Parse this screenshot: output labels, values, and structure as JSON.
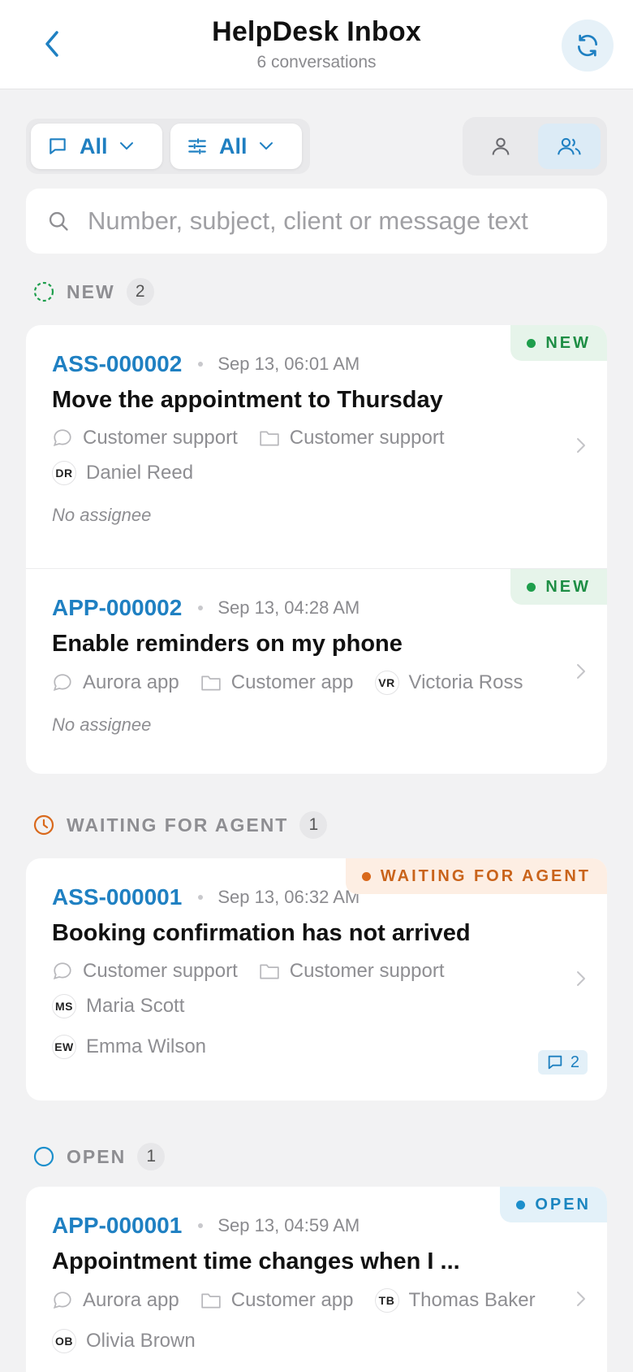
{
  "header": {
    "title": "HelpDesk Inbox",
    "subtitle": "6 conversations"
  },
  "filters": {
    "channel_label": "All",
    "options_label": "All"
  },
  "search": {
    "placeholder": "Number, subject, client or message text"
  },
  "sections": [
    {
      "label": "NEW",
      "count": "2",
      "color": "#1e9e4c"
    },
    {
      "label": "WAITING FOR AGENT",
      "count": "1",
      "color": "#d9691c"
    },
    {
      "label": "OPEN",
      "count": "1",
      "color": "#1c8fcc"
    }
  ],
  "tickets": [
    {
      "number": "ASS-000002",
      "date": "Sep 13, 06:01 AM",
      "subject": "Move the appointment to Thursday",
      "channel": "Customer support",
      "folder": "Customer support",
      "client_initials": "DR",
      "client": "Daniel Reed",
      "assignee": "No assignee",
      "badge": "NEW"
    },
    {
      "number": "APP-000002",
      "date": "Sep 13, 04:28 AM",
      "subject": "Enable reminders on my phone",
      "channel": "Aurora app",
      "folder": "Customer app",
      "client_initials": "VR",
      "client": "Victoria Ross",
      "assignee": "No assignee",
      "badge": "NEW"
    },
    {
      "number": "ASS-000001",
      "date": "Sep 13, 06:32 AM",
      "subject": "Booking confirmation has not arrived",
      "channel": "Customer support",
      "folder": "Customer support",
      "client_initials": "MS",
      "client": "Maria Scott",
      "assignee_initials": "EW",
      "assignee": "Emma Wilson",
      "messages": "2",
      "badge": "WAITING FOR AGENT"
    },
    {
      "number": "APP-000001",
      "date": "Sep 13, 04:59 AM",
      "subject": "Appointment time changes when I ...",
      "channel": "Aurora app",
      "folder": "Customer app",
      "client_initials": "TB",
      "client": "Thomas Baker",
      "assignee_initials": "OB",
      "assignee": "Olivia Brown",
      "badge": "OPEN"
    }
  ],
  "colors": {
    "accent": "#1f80c2",
    "background": "#f2f2f3"
  }
}
